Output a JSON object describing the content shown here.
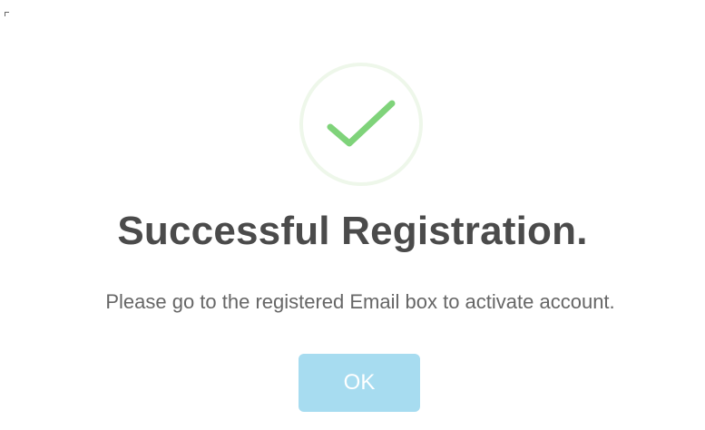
{
  "icon": {
    "name": "checkmark-icon",
    "color": "#7fd37a",
    "ring_color": "#eef7ea"
  },
  "title": "Successful Registration.",
  "message": "Please go to the registered Email box to activate account.",
  "ok_button": {
    "label": "OK",
    "color": "#a7dcf0"
  }
}
